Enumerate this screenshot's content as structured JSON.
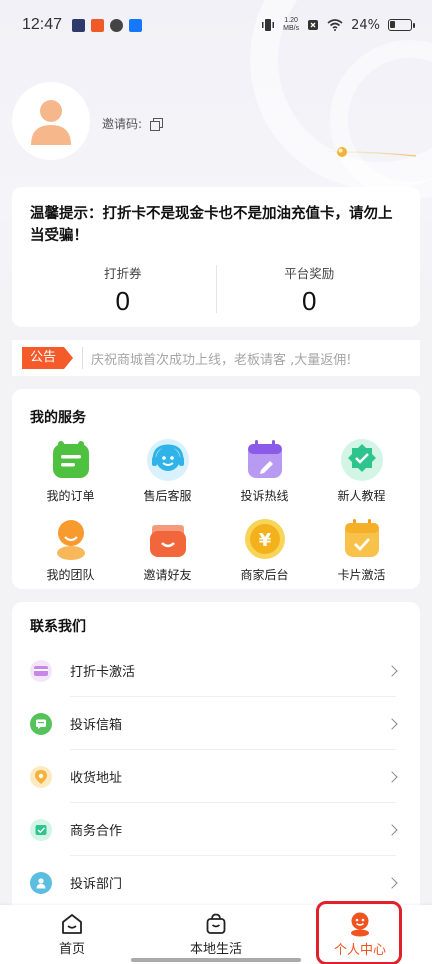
{
  "status_bar": {
    "time": "12:47",
    "net_speed_top": "1.20",
    "net_speed_bottom": "MB/s",
    "battery": "24%",
    "battery_level": 0.24
  },
  "profile": {
    "invite_label": "邀请码:"
  },
  "notice": {
    "text": "温馨提示：打折卡不是现金卡也不是加油充值卡，请勿上当受骗！",
    "stats": [
      {
        "label": "打折券",
        "value": "0"
      },
      {
        "label": "平台奖励",
        "value": "0"
      }
    ]
  },
  "announcement": {
    "tag": "公告",
    "text": "庆祝商城首次成功上线，老板请客 ,大量返佣!"
  },
  "services": {
    "title": "我的服务",
    "items": [
      {
        "label": "我的订单",
        "icon": "order-icon"
      },
      {
        "label": "售后客服",
        "icon": "customer-service-icon"
      },
      {
        "label": "投诉热线",
        "icon": "hotline-icon"
      },
      {
        "label": "新人教程",
        "icon": "tutorial-icon"
      },
      {
        "label": "我的团队",
        "icon": "team-icon"
      },
      {
        "label": "邀请好友",
        "icon": "invite-friends-icon"
      },
      {
        "label": "商家后台",
        "icon": "merchant-icon"
      },
      {
        "label": "卡片激活",
        "icon": "card-activate-icon"
      }
    ]
  },
  "contact": {
    "title": "联系我们",
    "items": [
      {
        "label": "打折卡激活",
        "icon": "card-icon",
        "color": "#c985e8"
      },
      {
        "label": "投诉信箱",
        "icon": "mailbox-icon",
        "color": "#56c35a"
      },
      {
        "label": "收货地址",
        "icon": "location-icon",
        "color": "#f5b23a"
      },
      {
        "label": "商务合作",
        "icon": "cooperation-icon",
        "color": "#2ec48e"
      },
      {
        "label": "投诉部门",
        "icon": "department-icon",
        "color": "#5bbde0"
      }
    ]
  },
  "tabbar": {
    "tabs": [
      {
        "label": "首页",
        "icon": "home-icon"
      },
      {
        "label": "本地生活",
        "icon": "shopping-bag-icon"
      },
      {
        "label": "个人中心",
        "icon": "profile-icon"
      }
    ],
    "active_color": "#f1531f"
  }
}
